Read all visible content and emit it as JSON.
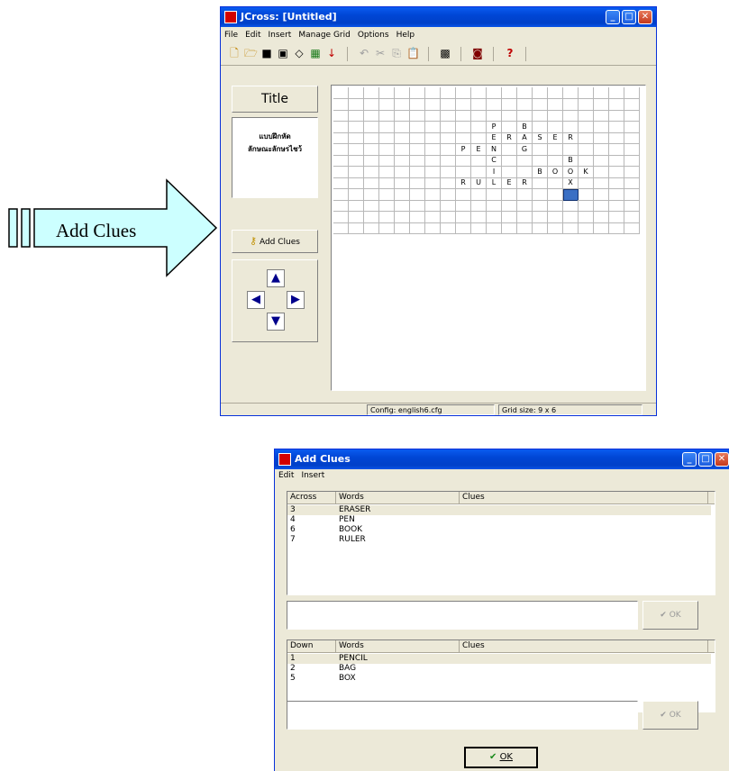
{
  "main_window": {
    "title": "JCross: [Untitled]",
    "menu": [
      "File",
      "Edit",
      "Insert",
      "Manage Grid",
      "Options",
      "Help"
    ],
    "title_button": "Title",
    "title_text_line1": "แบบฝึกหัด",
    "title_text_line2": "ลักษณะลักษรไชว้",
    "add_clues_button": "Add Clues",
    "status_config": "Config: english6.cfg",
    "status_grid": "Grid size: 9 x 6",
    "grid": {
      "rows": 13,
      "cols": 20,
      "letters": [
        {
          "r": 3,
          "c": 10,
          "ch": "P"
        },
        {
          "r": 3,
          "c": 12,
          "ch": "B"
        },
        {
          "r": 4,
          "c": 10,
          "ch": "E"
        },
        {
          "r": 4,
          "c": 11,
          "ch": "R"
        },
        {
          "r": 4,
          "c": 12,
          "ch": "A"
        },
        {
          "r": 4,
          "c": 13,
          "ch": "S"
        },
        {
          "r": 4,
          "c": 14,
          "ch": "E"
        },
        {
          "r": 4,
          "c": 15,
          "ch": "R"
        },
        {
          "r": 5,
          "c": 8,
          "ch": "P"
        },
        {
          "r": 5,
          "c": 9,
          "ch": "E"
        },
        {
          "r": 5,
          "c": 10,
          "ch": "N"
        },
        {
          "r": 5,
          "c": 12,
          "ch": "G"
        },
        {
          "r": 6,
          "c": 10,
          "ch": "C"
        },
        {
          "r": 6,
          "c": 15,
          "ch": "B"
        },
        {
          "r": 7,
          "c": 10,
          "ch": "I"
        },
        {
          "r": 7,
          "c": 13,
          "ch": "B"
        },
        {
          "r": 7,
          "c": 14,
          "ch": "O"
        },
        {
          "r": 7,
          "c": 15,
          "ch": "O"
        },
        {
          "r": 7,
          "c": 16,
          "ch": "K"
        },
        {
          "r": 8,
          "c": 8,
          "ch": "R"
        },
        {
          "r": 8,
          "c": 9,
          "ch": "U"
        },
        {
          "r": 8,
          "c": 10,
          "ch": "L"
        },
        {
          "r": 8,
          "c": 11,
          "ch": "E"
        },
        {
          "r": 8,
          "c": 12,
          "ch": "R"
        },
        {
          "r": 8,
          "c": 15,
          "ch": "X"
        }
      ],
      "selected": {
        "r": 9,
        "c": 15
      }
    }
  },
  "callout": {
    "label": "Add Clues",
    "fill": "#ccffff"
  },
  "dialog": {
    "title": "Add Clues",
    "menu": [
      "Edit",
      "Insert"
    ],
    "across": {
      "headers": [
        "Across",
        "Words",
        "Clues"
      ],
      "rows": [
        {
          "num": "3",
          "word": "ERASER",
          "clue": ""
        },
        {
          "num": "4",
          "word": "PEN",
          "clue": ""
        },
        {
          "num": "6",
          "word": "BOOK",
          "clue": ""
        },
        {
          "num": "7",
          "word": "RULER",
          "clue": ""
        }
      ],
      "ok_label": "OK"
    },
    "down": {
      "headers": [
        "Down",
        "Words",
        "Clues"
      ],
      "rows": [
        {
          "num": "1",
          "word": "PENCIL",
          "clue": ""
        },
        {
          "num": "2",
          "word": "BAG",
          "clue": ""
        },
        {
          "num": "5",
          "word": "BOX",
          "clue": ""
        }
      ],
      "ok_label": "OK"
    },
    "ok_button": "OK"
  }
}
